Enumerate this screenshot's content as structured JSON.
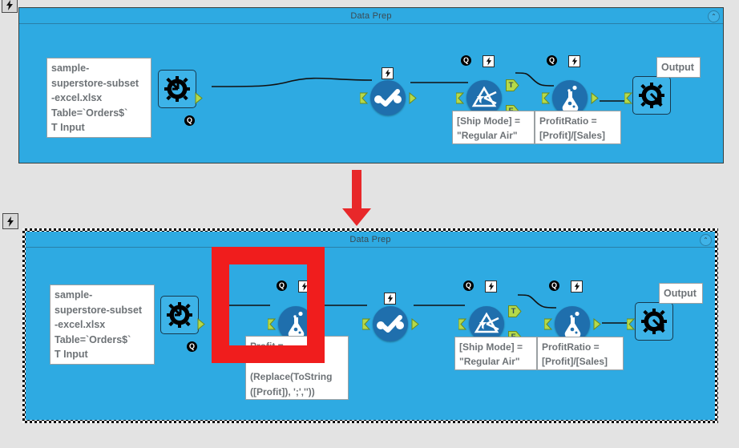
{
  "app": {
    "tool_names": {
      "input": "input-data-tool",
      "select": "select-tool",
      "filter": "filter-tool",
      "formula": "formula-tool",
      "output": "output-data-tool"
    }
  },
  "float_icons": {
    "top_left": "lightning-icon",
    "bottom_left": "lightning-icon"
  },
  "panels": [
    {
      "id": "before",
      "title": "Data Prep",
      "collapse_glyph": "⌃",
      "input_annotation": "sample-\nsuperstore-subset\n-excel.xlsx\nTable=`Orders$`\nT Input",
      "filter_annotation": "[Ship Mode] =\n\"Regular Air\"",
      "formula_annotation": "ProfitRatio =\n[Profit]/[Sales]",
      "output_annotation": "Output",
      "port_labels": {
        "true": "T",
        "false": "F"
      },
      "badge_q": "Q"
    },
    {
      "id": "after",
      "title": "Data Prep",
      "collapse_glyph": "⌃",
      "input_annotation": "sample-\nsuperstore-subset\n-excel.xlsx\nTable=`Orders$`\nT Input",
      "new_formula_annotation": "Profit =\n\n(Replace(ToString\n([Profit]), ';',''))",
      "filter_annotation": "[Ship Mode] =\n\"Regular Air\"",
      "formula_annotation": "ProfitRatio =\n[Profit]/[Sales]",
      "output_annotation": "Output",
      "port_labels": {
        "true": "T",
        "false": "F"
      },
      "badge_q": "Q"
    }
  ],
  "highlight": {
    "name": "red-highlight-box",
    "color": "#f01d1d",
    "target": "new-formula-tool"
  },
  "transition_arrow": {
    "name": "red-down-arrow",
    "color": "#e8282a",
    "direction": "down"
  },
  "colors": {
    "canvas": "#2eaae2",
    "node": "#1f6fad",
    "port": "#b5d94a",
    "page_bg": "#e3e3e3",
    "text": "#6d7276"
  }
}
